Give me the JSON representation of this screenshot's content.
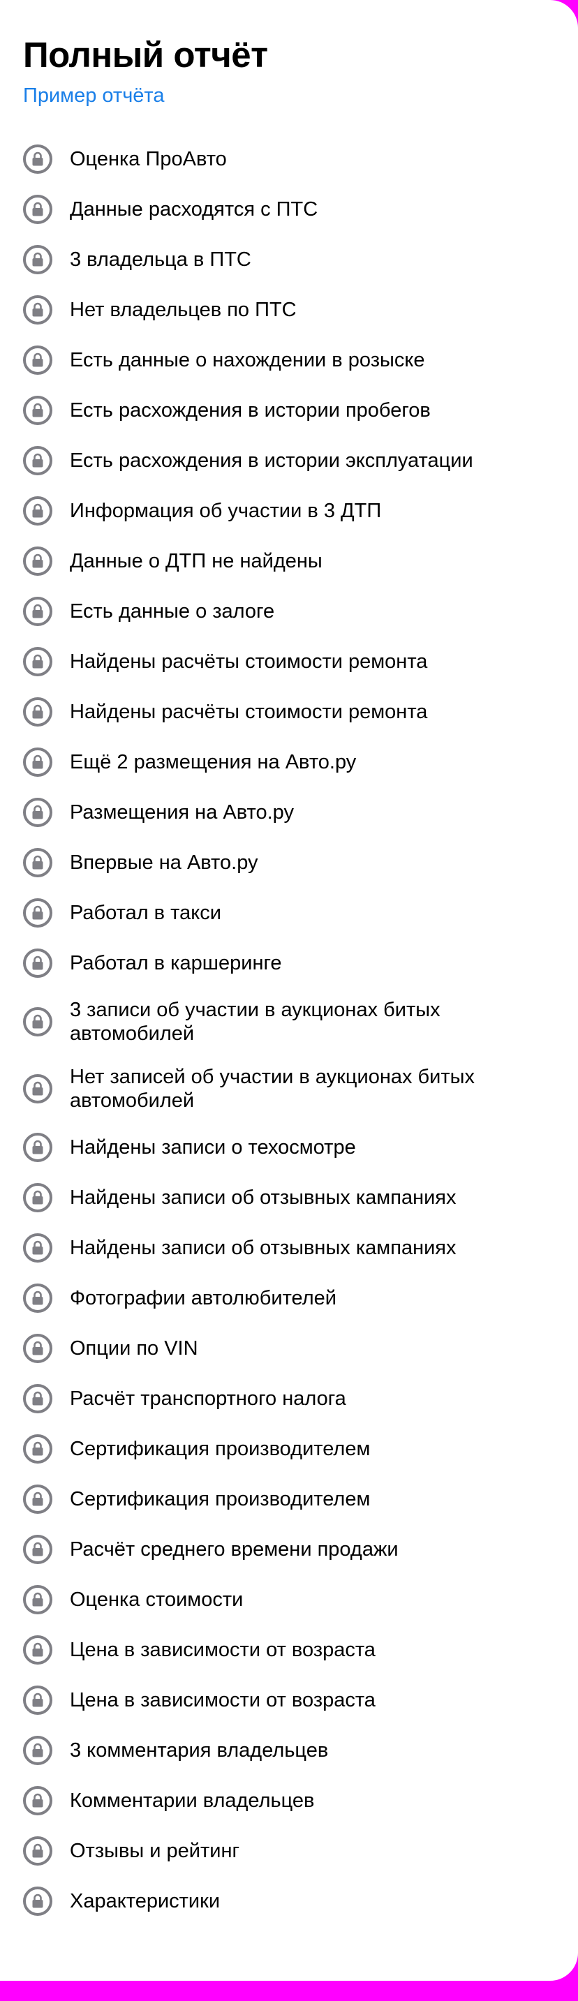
{
  "header": {
    "title": "Полный отчёт",
    "sample_link": "Пример отчёта"
  },
  "colors": {
    "link": "#1a7fe8",
    "lock_icon": "#7f7f85",
    "background": "#ff00ff"
  },
  "icon": "lock-icon",
  "items": [
    {
      "label": "Оценка ПроАвто"
    },
    {
      "label": "Данные расходятся с ПТС"
    },
    {
      "label": "3 владельца в ПТС"
    },
    {
      "label": "Нет владельцев по ПТС"
    },
    {
      "label": "Есть данные о нахождении в розыске"
    },
    {
      "label": "Есть расхождения в истории пробегов"
    },
    {
      "label": "Есть расхождения в истории эксплуатации"
    },
    {
      "label": "Информация об участии в 3 ДТП"
    },
    {
      "label": "Данные о ДТП не найдены"
    },
    {
      "label": "Есть данные о залоге"
    },
    {
      "label": "Найдены расчёты стоимости ремонта"
    },
    {
      "label": "Найдены расчёты стоимости ремонта"
    },
    {
      "label": "Ещё 2 размещения на Авто.ру"
    },
    {
      "label": "Размещения на Авто.ру"
    },
    {
      "label": "Впервые на Авто.ру"
    },
    {
      "label": "Работал в такси"
    },
    {
      "label": "Работал в каршеринге"
    },
    {
      "label": "3 записи об участии в аукционах битых автомобилей"
    },
    {
      "label": "Нет записей об участии в аукционах битых автомобилей"
    },
    {
      "label": "Найдены записи о техосмотре"
    },
    {
      "label": "Найдены записи об отзывных кампаниях"
    },
    {
      "label": "Найдены записи об отзывных кампаниях"
    },
    {
      "label": "Фотографии автолюбителей"
    },
    {
      "label": "Опции по VIN"
    },
    {
      "label": "Расчёт транспортного налога"
    },
    {
      "label": "Сертификация производителем"
    },
    {
      "label": "Сертификация производителем"
    },
    {
      "label": "Расчёт среднего времени продажи"
    },
    {
      "label": "Оценка стоимости"
    },
    {
      "label": "Цена в зависимости от возраста"
    },
    {
      "label": "Цена в зависимости от возраста"
    },
    {
      "label": "3 комментария владельцев"
    },
    {
      "label": "Комментарии владельцев"
    },
    {
      "label": "Отзывы и рейтинг"
    },
    {
      "label": "Характеристики"
    }
  ]
}
